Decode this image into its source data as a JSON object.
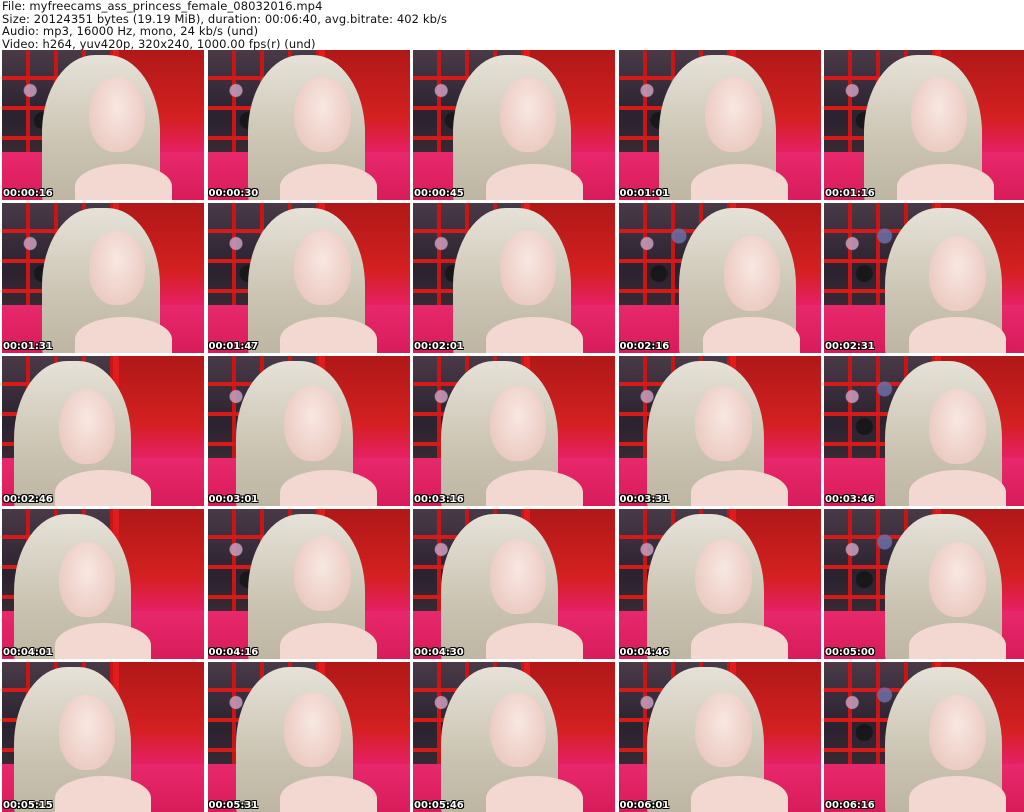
{
  "header": {
    "file": "File: myfreecams_ass_princess_female_08032016.mp4",
    "size": "Size: 20124351 bytes (19.19 MiB), duration: 00:06:40, avg.bitrate: 402 kb/s",
    "audio": "Audio: mp3, 16000 Hz, mono, 24 kb/s (und)",
    "video": "Video: h264, yuv420p, 320x240, 1000.00 fps(r) (und)"
  },
  "thumbnails": [
    {
      "time": "00:00:16",
      "variant": "v0"
    },
    {
      "time": "00:00:30",
      "variant": "v0"
    },
    {
      "time": "00:00:45",
      "variant": "v0"
    },
    {
      "time": "00:01:01",
      "variant": "v0"
    },
    {
      "time": "00:01:16",
      "variant": "v0"
    },
    {
      "time": "00:01:31",
      "variant": "v0"
    },
    {
      "time": "00:01:47",
      "variant": "v0"
    },
    {
      "time": "00:02:01",
      "variant": "v0"
    },
    {
      "time": "00:02:16",
      "variant": "v2"
    },
    {
      "time": "00:02:31",
      "variant": "v2"
    },
    {
      "time": "00:02:46",
      "variant": "v1"
    },
    {
      "time": "00:03:01",
      "variant": "v3"
    },
    {
      "time": "00:03:16",
      "variant": "v3"
    },
    {
      "time": "00:03:31",
      "variant": "v3"
    },
    {
      "time": "00:03:46",
      "variant": "v2"
    },
    {
      "time": "00:04:01",
      "variant": "v1"
    },
    {
      "time": "00:04:16",
      "variant": "v0"
    },
    {
      "time": "00:04:30",
      "variant": "v3"
    },
    {
      "time": "00:04:46",
      "variant": "v3"
    },
    {
      "time": "00:05:00",
      "variant": "v2"
    },
    {
      "time": "00:05:15",
      "variant": "v1"
    },
    {
      "time": "00:05:31",
      "variant": "v3"
    },
    {
      "time": "00:05:46",
      "variant": "v3"
    },
    {
      "time": "00:06:01",
      "variant": "v3"
    },
    {
      "time": "00:06:16",
      "variant": "v2"
    }
  ]
}
